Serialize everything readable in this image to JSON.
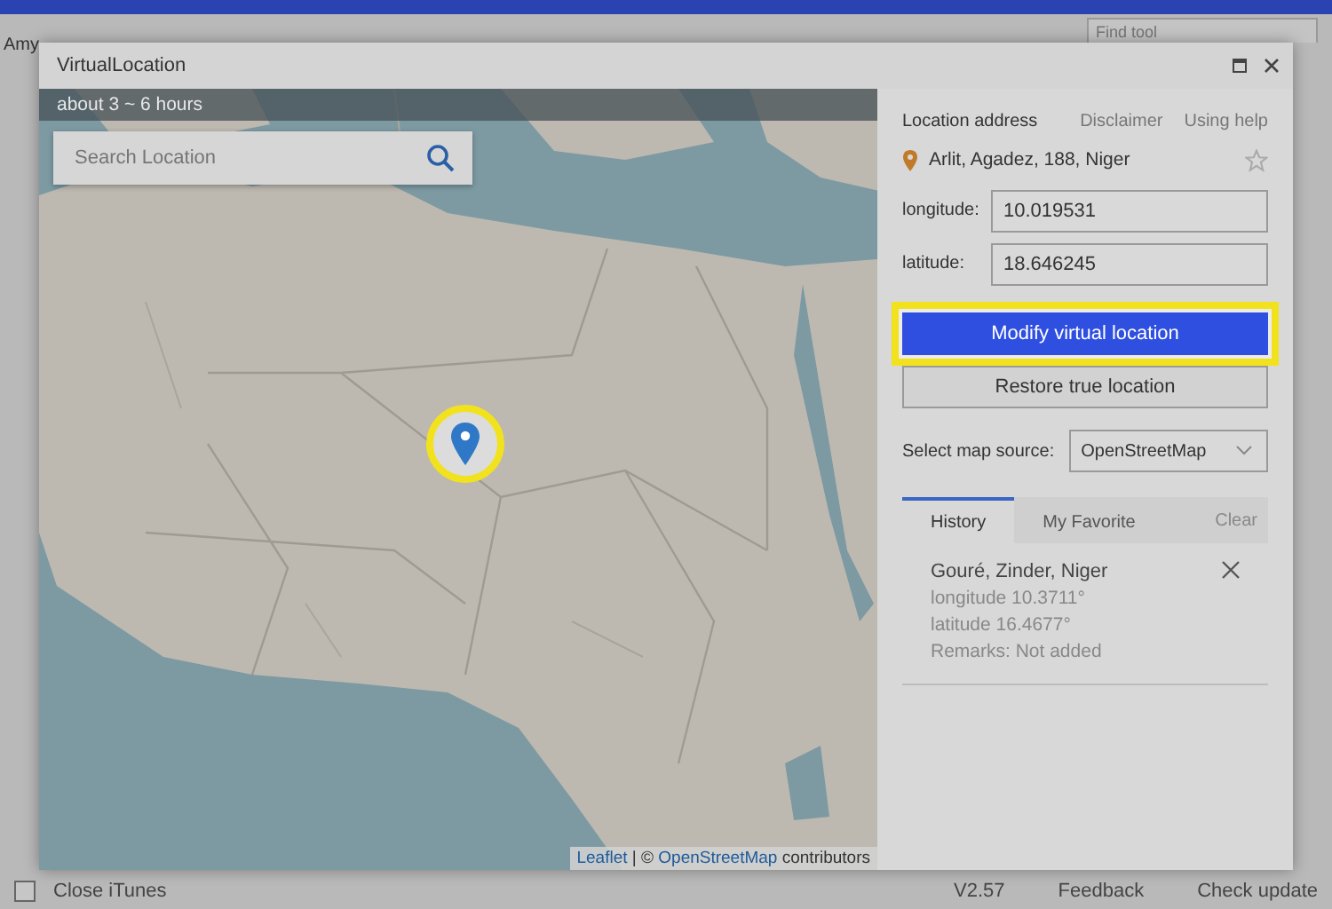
{
  "background_app": {
    "header_tab": "Amy",
    "search": {
      "placeholder": "Find tool"
    },
    "footer": {
      "close_itunes": {
        "label": "Close iTunes",
        "checked": false
      },
      "version": "V2.57",
      "links": [
        "Feedback",
        "Check update"
      ]
    }
  },
  "dialog": {
    "title": "VirtualLocation",
    "map": {
      "kind": "picture",
      "banner": "about 3 ~ 6 hours",
      "search": {
        "placeholder": "Search Location"
      },
      "marker": {
        "highlighted": true
      },
      "attribution": {
        "leaflet": "Leaflet",
        "separator": "| ©",
        "osm": "OpenStreetMap",
        "text": "contributors"
      }
    },
    "panel": {
      "heading": "Location address",
      "links": [
        "Disclaimer",
        "Using help"
      ],
      "address": "Arlit, Agadez, 188, Niger",
      "favorite": false,
      "fields": [
        {
          "label": "longitude:",
          "value": "10.019531"
        },
        {
          "label": "latitude:",
          "value": "18.646245"
        }
      ],
      "primary_button": {
        "label": "Modify virtual location",
        "highlighted": true
      },
      "secondary_button": "Restore true location",
      "map_source": {
        "label": "Select map source:",
        "value": "OpenStreetMap"
      },
      "tabs": [
        {
          "label": "History",
          "selected": true
        },
        {
          "label": "My Favorite",
          "selected": false
        }
      ],
      "clear": "Clear",
      "history": [
        {
          "place": "Gouré, Zinder, Niger",
          "longitude": "longitude 10.3711°",
          "latitude": "latitude 16.4677°",
          "remarks": "Remarks: Not added"
        }
      ]
    }
  }
}
